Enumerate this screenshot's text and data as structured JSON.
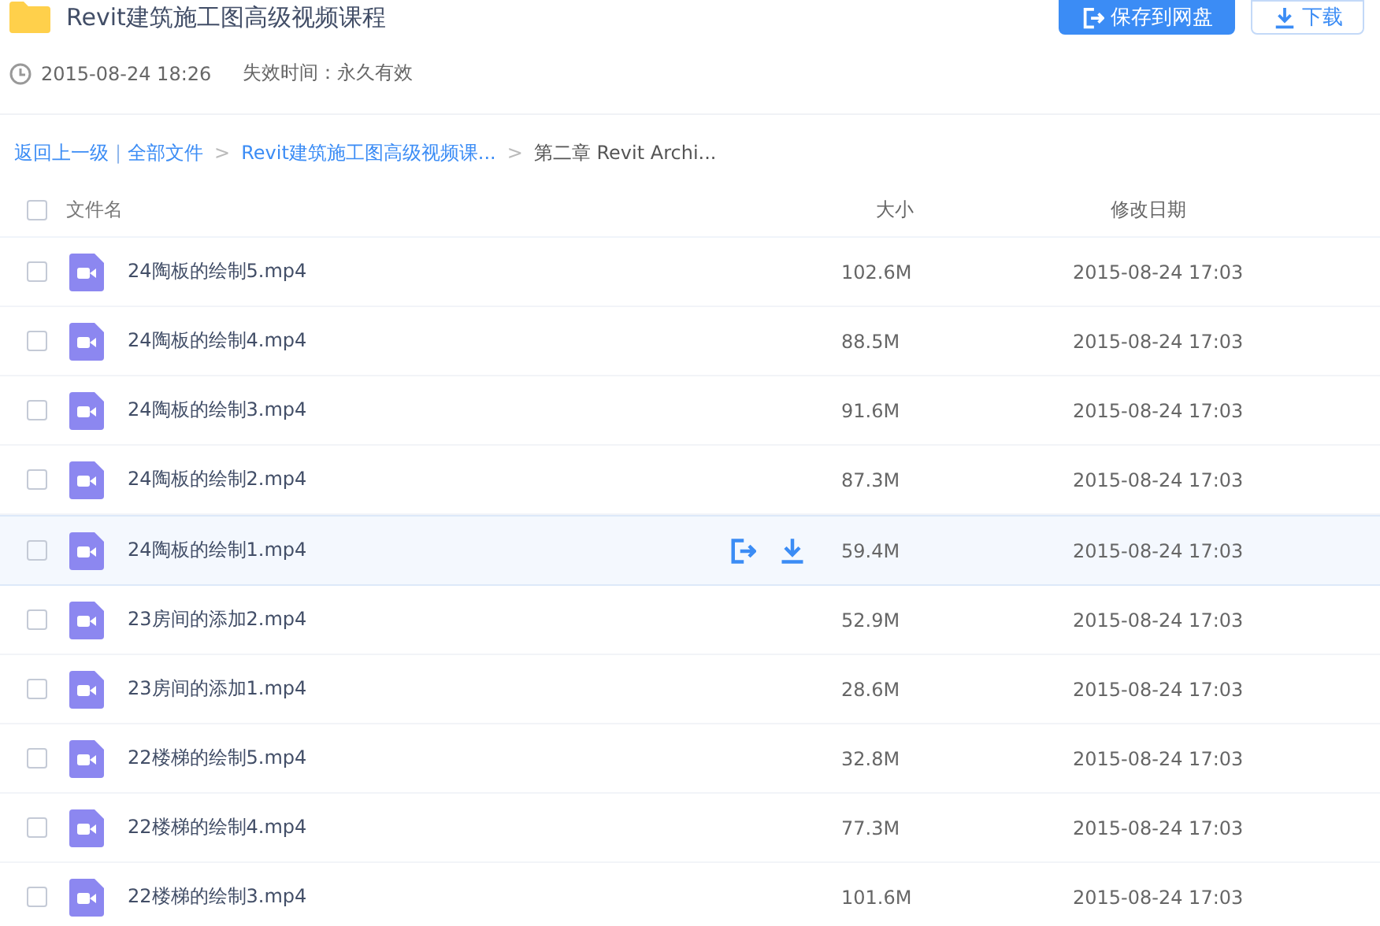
{
  "header": {
    "title": "Revit建筑施工图高级视频课程",
    "buttons": [
      {
        "label": "保存到网盘",
        "kind": "primary"
      },
      {
        "label": "下载",
        "kind": "secondary"
      }
    ],
    "created": "2015-08-24 18:26",
    "expiry": "失效时间：永久有效"
  },
  "breadcrumb": {
    "back": "返回上一级",
    "separator": "|",
    "items": [
      {
        "label": "全部文件",
        "kind": "link"
      },
      {
        "label": "Revit建筑施工图高级视频课...",
        "kind": "link"
      },
      {
        "label": "第二章 Revit Archi...",
        "kind": "current"
      }
    ],
    "arrow": ">"
  },
  "table": {
    "columns": [
      "文件名",
      "大小",
      "修改日期"
    ],
    "select_all": {
      "checked": false
    },
    "rows": [
      {
        "name": "24陶板的绘制5.mp4",
        "size": "102.6M",
        "date": "2015-08-24 17:03",
        "checked": false,
        "hovered": false
      },
      {
        "name": "24陶板的绘制4.mp4",
        "size": "88.5M",
        "date": "2015-08-24 17:03",
        "checked": false,
        "hovered": false
      },
      {
        "name": "24陶板的绘制3.mp4",
        "size": "91.6M",
        "date": "2015-08-24 17:03",
        "checked": false,
        "hovered": false
      },
      {
        "name": "24陶板的绘制2.mp4",
        "size": "87.3M",
        "date": "2015-08-24 17:03",
        "checked": false,
        "hovered": false
      },
      {
        "name": "24陶板的绘制1.mp4",
        "size": "59.4M",
        "date": "2015-08-24 17:03",
        "checked": false,
        "hovered": true
      },
      {
        "name": "23房间的添加2.mp4",
        "size": "52.9M",
        "date": "2015-08-24 17:03",
        "checked": false,
        "hovered": false
      },
      {
        "name": "23房间的添加1.mp4",
        "size": "28.6M",
        "date": "2015-08-24 17:03",
        "checked": false,
        "hovered": false
      },
      {
        "name": "22楼梯的绘制5.mp4",
        "size": "32.8M",
        "date": "2015-08-24 17:03",
        "checked": false,
        "hovered": false
      },
      {
        "name": "22楼梯的绘制4.mp4",
        "size": "77.3M",
        "date": "2015-08-24 17:03",
        "checked": false,
        "hovered": false
      },
      {
        "name": "22楼梯的绘制3.mp4",
        "size": "101.6M",
        "date": "2015-08-24 17:03",
        "checked": false,
        "hovered": false
      }
    ]
  }
}
